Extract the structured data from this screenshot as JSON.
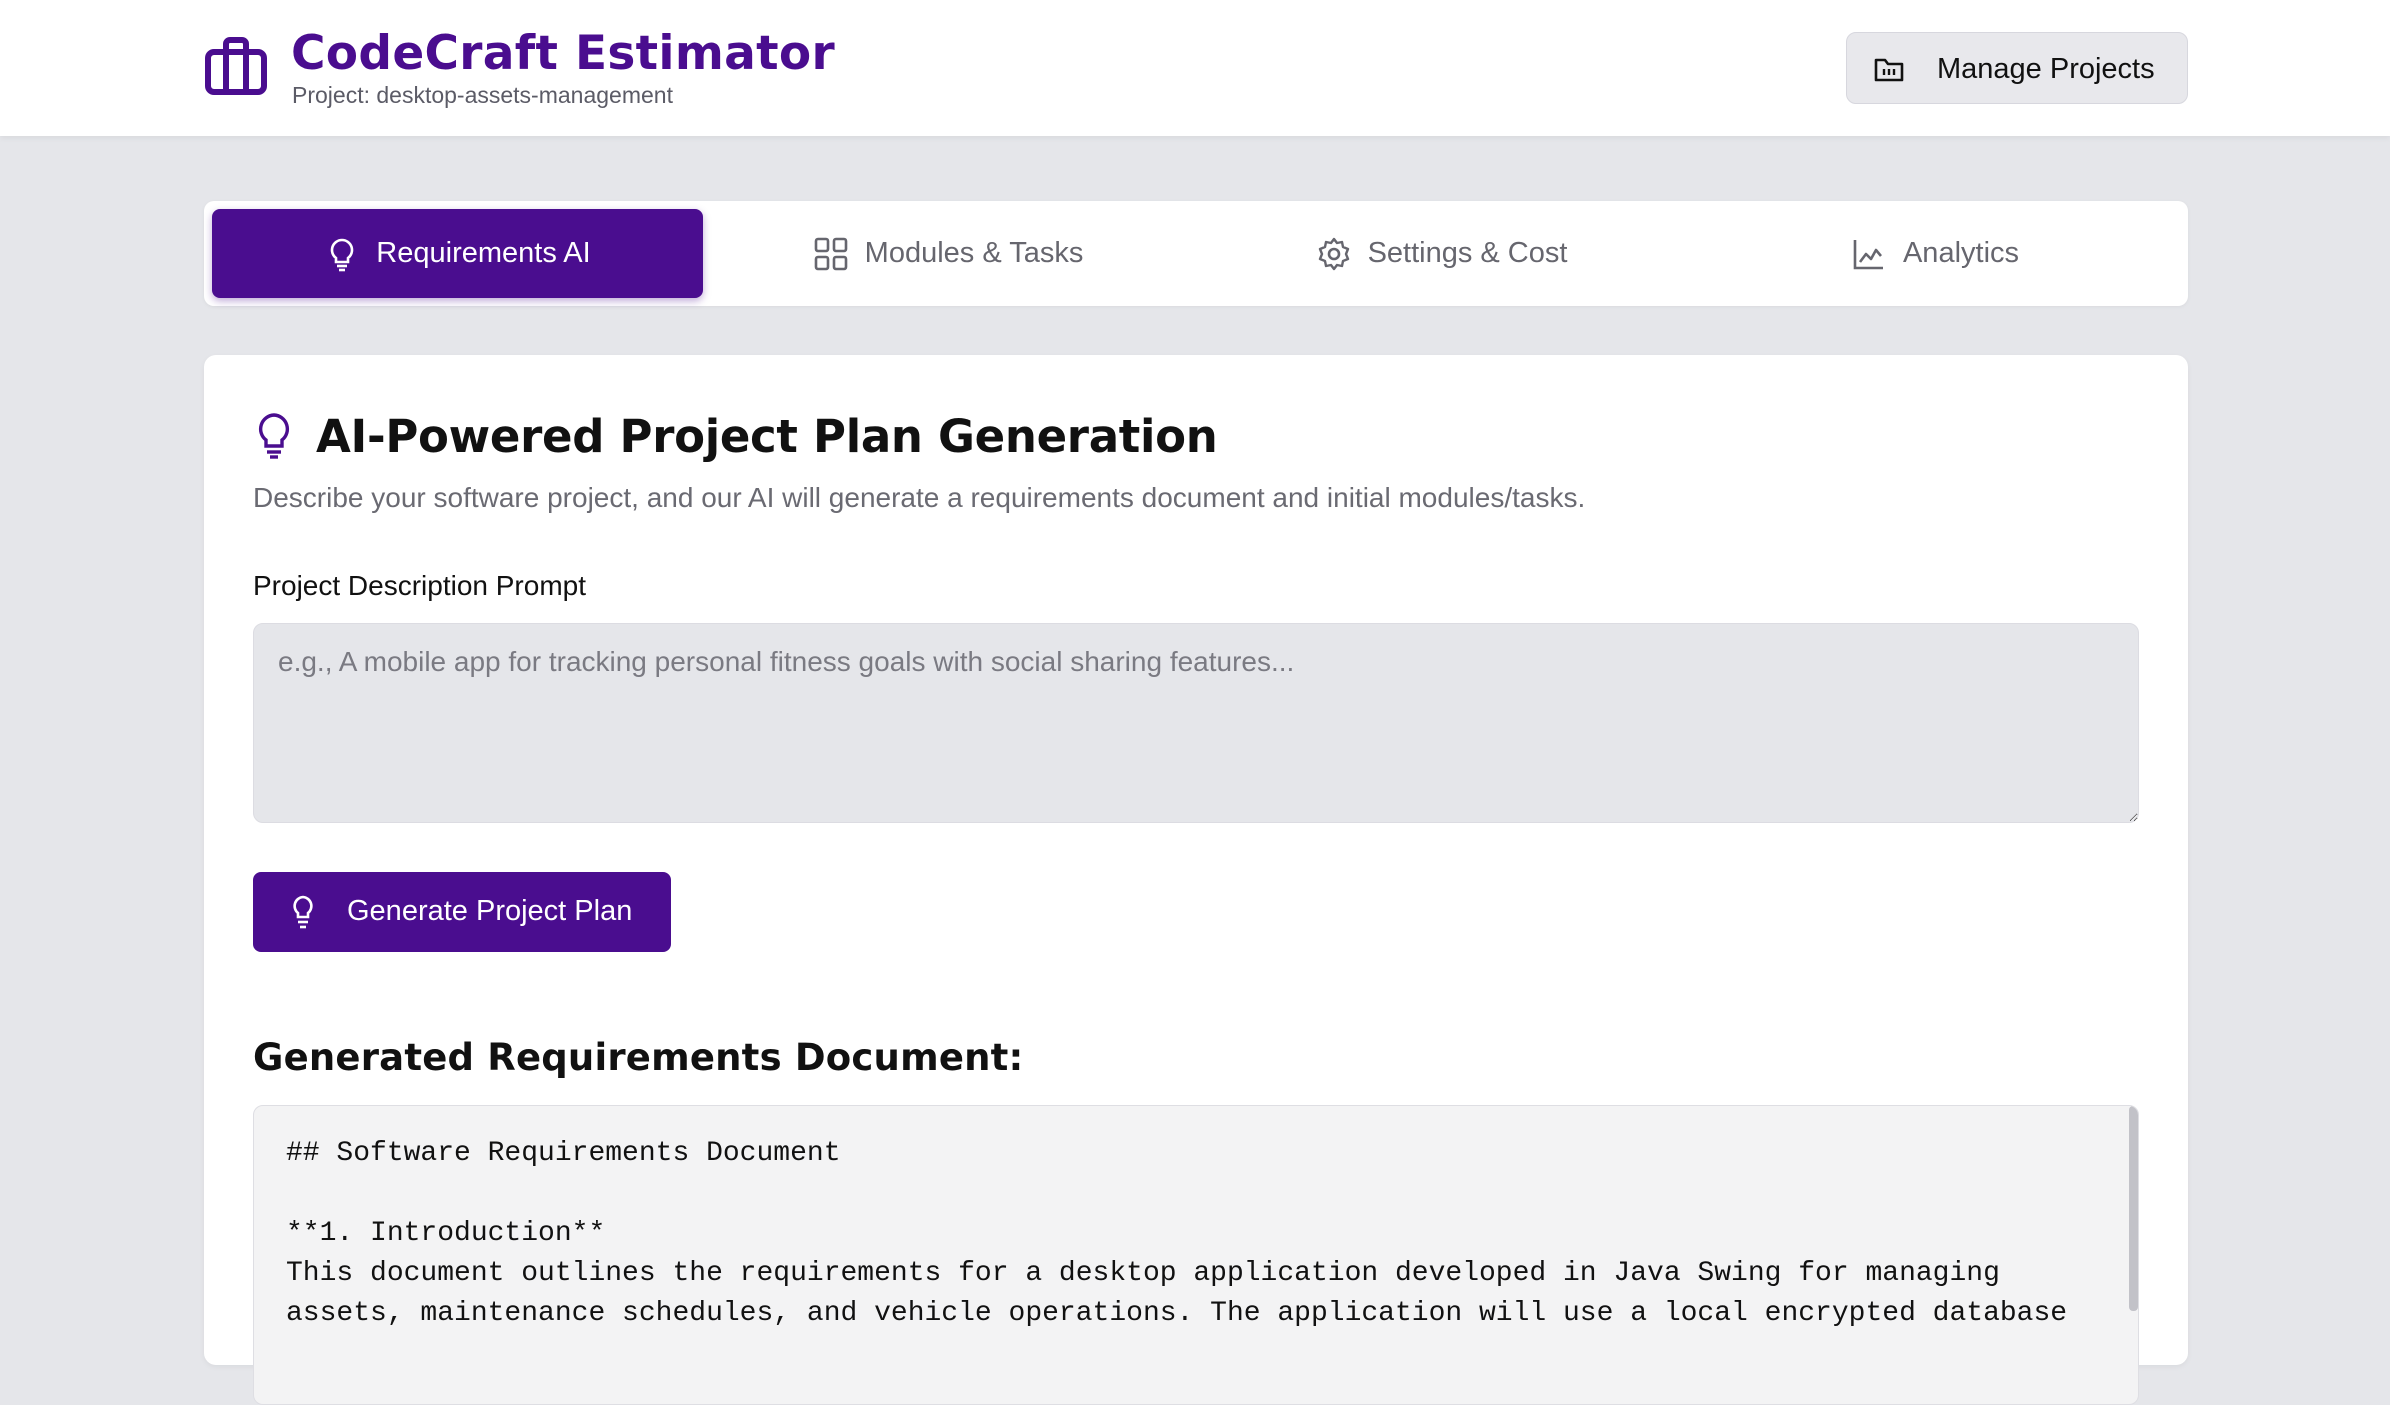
{
  "app": {
    "title": "CodeCraft Estimator",
    "project_line": "Project: desktop-assets-management",
    "brand_icon": "briefcase-icon",
    "brand_color": "#4a0d8f"
  },
  "header": {
    "manage_projects_label": "Manage Projects",
    "manage_projects_icon": "folder-icon"
  },
  "tabs": [
    {
      "label": "Requirements AI",
      "icon": "lightbulb-icon",
      "active": true
    },
    {
      "label": "Modules & Tasks",
      "icon": "grid-icon",
      "active": false
    },
    {
      "label": "Settings & Cost",
      "icon": "gear-icon",
      "active": false
    },
    {
      "label": "Analytics",
      "icon": "chart-icon",
      "active": false
    }
  ],
  "main": {
    "title": "AI-Powered Project Plan Generation",
    "description": "Describe your software project, and our AI will generate a requirements document and initial modules/tasks.",
    "prompt_label": "Project Description Prompt",
    "prompt_value": "",
    "prompt_placeholder": "e.g., A mobile app for tracking personal fitness goals with social sharing features...",
    "generate_label": "Generate Project Plan",
    "doc_title": "Generated Requirements Document:",
    "doc_text": "## Software Requirements Document\n\n**1. Introduction**\nThis document outlines the requirements for a desktop application developed in Java Swing for managing\nassets, maintenance schedules, and vehicle operations. The application will use a local encrypted database"
  }
}
